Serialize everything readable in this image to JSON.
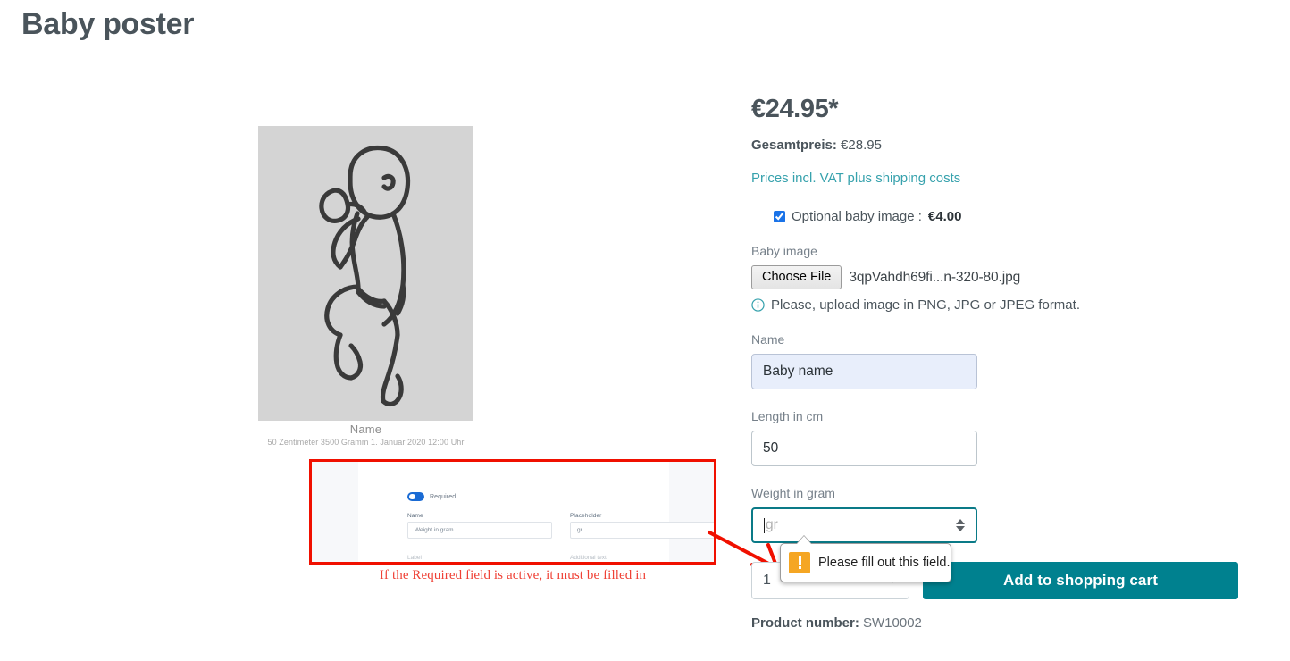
{
  "page": {
    "title": "Baby poster"
  },
  "poster": {
    "alt": "baby-line-drawing",
    "caption_name": "Name",
    "caption_meta": "50 Zentimeter   3500 Gramm   1. Januar 2020   12:00 Uhr"
  },
  "annotation": {
    "caption": "If the Required field is active, it must be filled in",
    "border_color": "#f01000",
    "text_color": "#ef4136",
    "inset": {
      "toggle_label": "Required",
      "toggle_on": true,
      "name_label": "Name",
      "name_value": "Weight in gram",
      "placeholder_label": "Placeholder",
      "placeholder_value": "gr",
      "partial_left": "Label",
      "partial_right": "Additional text"
    }
  },
  "buybox": {
    "price": "€24.95*",
    "total_label": "Gesamtpreis:",
    "total_value": "€28.95",
    "vat_link": "Prices incl. VAT plus shipping costs",
    "vat_link_color": "#37a2ad",
    "option": {
      "label": "Optional baby image :",
      "price": "€4.00",
      "checked": true,
      "checkbox_color": "#1a73e8"
    },
    "file_field": {
      "label": "Baby image",
      "button_label": "Choose File",
      "file_name": "3qpVahdh69fi...n-320-80.jpg",
      "hint": "Please, upload image in PNG, JPG or JPEG format.",
      "hint_icon": "info-circle-icon",
      "hint_icon_color": "#37a2ad"
    },
    "name_field": {
      "label": "Name",
      "value": "Baby name"
    },
    "length_field": {
      "label": "Length in cm",
      "value": "50"
    },
    "weight_field": {
      "label": "Weight in gram",
      "value": "",
      "placeholder": "gr",
      "focus_color": "#0a7a87"
    },
    "quantity": {
      "value": "1"
    },
    "cart_button": {
      "label": "Add to shopping cart",
      "color": "#00818f"
    },
    "product_number_label": "Product number:",
    "product_number_value": "SW10002"
  },
  "validation": {
    "message": "Please fill out this field.",
    "icon": "warning-icon",
    "icon_color": "#f5a623"
  }
}
